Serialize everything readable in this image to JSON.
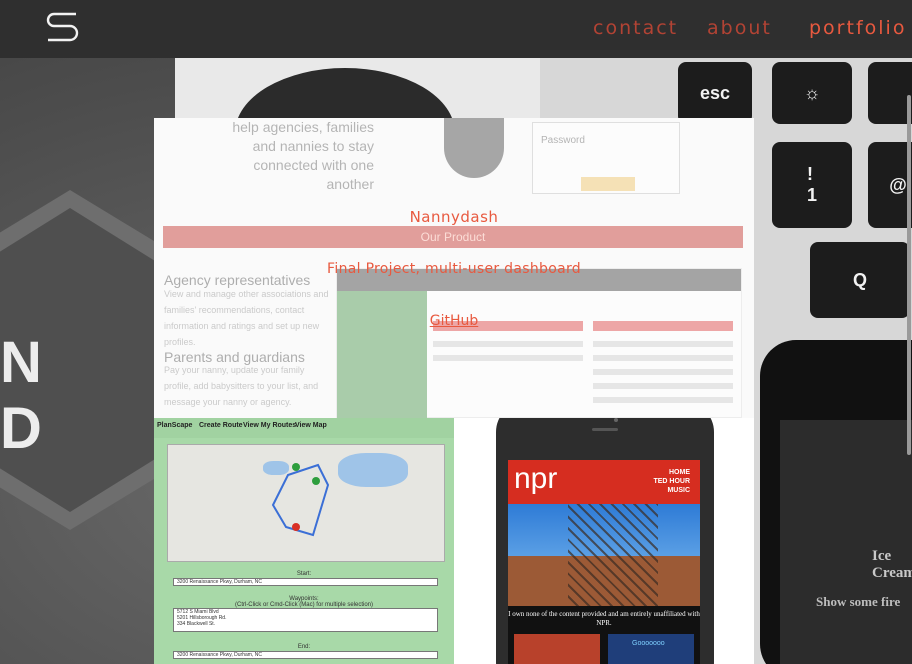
{
  "nav": {
    "logo_icon": "s-monogram-icon",
    "links": [
      {
        "label": "contact"
      },
      {
        "label": "about"
      },
      {
        "label": "portfolio",
        "active": true
      }
    ]
  },
  "portfolio": {
    "featured": {
      "title": "Nannydash",
      "description": "Final Project, multi-user dashboard",
      "link_label": "GitHub",
      "screenshot": {
        "tagline": "help agencies, families and nannies to stay connected with one another",
        "login_label": "Password",
        "banner": "Our Product",
        "sections": [
          {
            "heading": "Agency representatives",
            "text": "View and manage other associations and families' recommendations, contact information and ratings and set up new profiles."
          },
          {
            "heading": "Parents and guardians",
            "text": "Pay your nanny, update your family profile, add babysitters to your list, and message your nanny or agency."
          }
        ]
      }
    },
    "planscape": {
      "nav_items": [
        "PlanScape",
        "Create Route",
        "View My Routes",
        "View Map"
      ],
      "start_label": "Start:",
      "start_value": "3200 Renaissance Pkwy, Durham, NC",
      "waypoints_label": "Waypoints:",
      "waypoints_hint": "(Ctrl-Click or Cmd-Click (Mac) for multiple selection)",
      "waypoints": [
        "5712 S Miami Blvd",
        "5201 Hillsborough Rd.",
        "334 Blackwell St."
      ],
      "end_label": "End:",
      "end_value": "3200 Renaissance Pkwy, Durham, NC"
    },
    "npr": {
      "logo": "npr",
      "menu": [
        "HOME",
        "TED HOUR",
        "MUSIC"
      ],
      "notice": "I own none of the content provided and am entirely unaffiliated with NPR."
    }
  },
  "background": {
    "sticker_text": [
      "N",
      "D"
    ],
    "phone_text": [
      "Ice Cream",
      "Show some fire"
    ]
  },
  "colors": {
    "navbar": "#2f2f2f",
    "accent": "#e8593f",
    "nav_inactive": "#b24334"
  }
}
